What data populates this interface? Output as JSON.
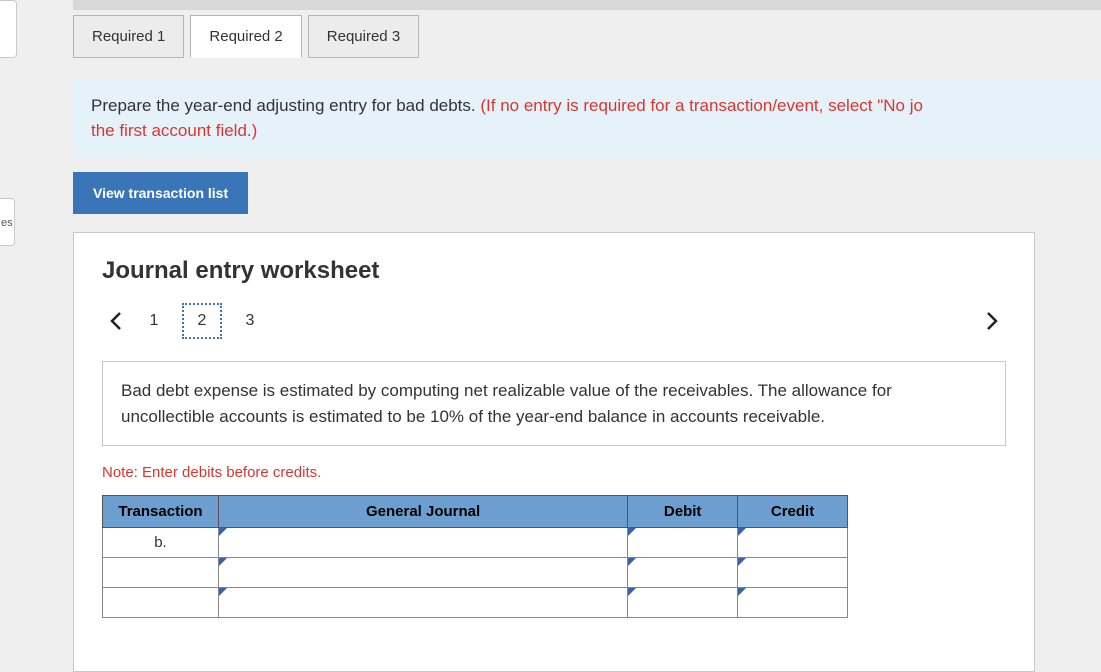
{
  "tabs": [
    "Required 1",
    "Required 2",
    "Required 3"
  ],
  "active_tab": 1,
  "left_stub": "es",
  "instruction": {
    "main": "Prepare the year-end adjusting entry for bad debts. ",
    "hint": "(If no entry is required for a transaction/event, select \"No jo",
    "hint2": "the first account field.)"
  },
  "view_btn": "View transaction list",
  "worksheet": {
    "title": "Journal entry worksheet",
    "steps": [
      "1",
      "2",
      "3"
    ],
    "active_step": 1,
    "description": "Bad debt expense is estimated by computing net realizable value of the receivables. The allowance for uncollectible accounts is estimated to be 10% of the year-end balance in accounts receivable.",
    "note": "Note: Enter debits before credits.",
    "headers": {
      "transaction": "Transaction",
      "general_journal": "General Journal",
      "debit": "Debit",
      "credit": "Credit"
    },
    "rows": [
      {
        "transaction": "b."
      },
      {
        "transaction": ""
      },
      {
        "transaction": ""
      }
    ]
  }
}
